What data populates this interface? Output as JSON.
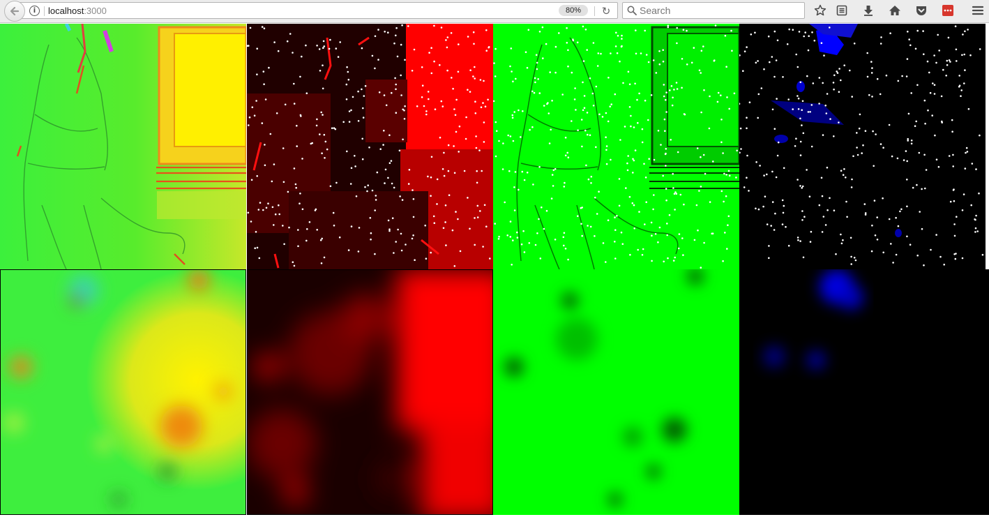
{
  "browser": {
    "url_host": "localhost",
    "url_port": ":3000",
    "zoom": "80%",
    "search_placeholder": "Search",
    "info_glyph": "i",
    "reload_glyph": "↻"
  },
  "panels": {
    "top": [
      {
        "id": "rgb-edges",
        "color": "#2fe82f"
      },
      {
        "id": "red-channel-edges",
        "color": "#ff0000"
      },
      {
        "id": "green-channel-edges",
        "color": "#00ff00"
      },
      {
        "id": "blue-channel-edges",
        "color": "#0000ff"
      }
    ],
    "bottom": [
      {
        "id": "rgb-blur",
        "color": "#3ddc2a"
      },
      {
        "id": "red-channel-blur",
        "color": "#ff0000"
      },
      {
        "id": "green-channel-blur",
        "color": "#00ff00"
      },
      {
        "id": "blue-channel-blur",
        "color": "#0000ff"
      }
    ]
  },
  "icons": [
    "back-arrow-icon",
    "info-icon",
    "reload-icon",
    "search-icon",
    "bookmark-star-icon",
    "reading-list-icon",
    "downloads-icon",
    "home-icon",
    "pocket-icon",
    "extension-icon",
    "menu-icon"
  ]
}
